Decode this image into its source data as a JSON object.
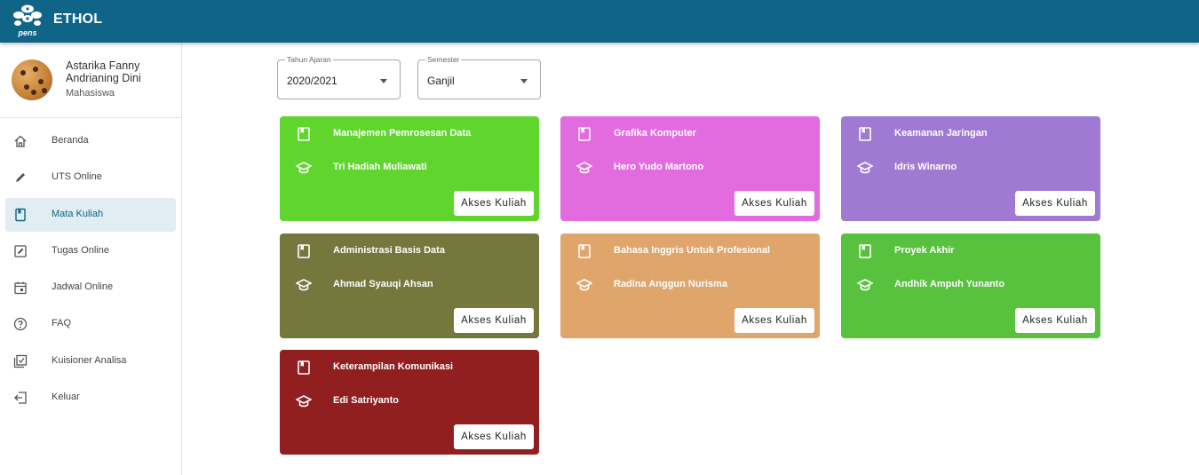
{
  "app": {
    "title": "ETHOL",
    "logo_text": "pens"
  },
  "user": {
    "name": "Astarika Fanny Andrianing Dini",
    "role": "Mahasiswa"
  },
  "nav": [
    {
      "label": "Beranda",
      "icon": "home-icon"
    },
    {
      "label": "UTS Online",
      "icon": "pen-icon"
    },
    {
      "label": "Mata Kuliah",
      "icon": "book-icon",
      "active": true
    },
    {
      "label": "Tugas Online",
      "icon": "edit-icon"
    },
    {
      "label": "Jadwal Online",
      "icon": "calendar-icon"
    },
    {
      "label": "FAQ",
      "icon": "help-icon"
    },
    {
      "label": "Kuisioner Analisa",
      "icon": "checklist-icon"
    },
    {
      "label": "Keluar",
      "icon": "logout-icon"
    }
  ],
  "filters": {
    "tahun": {
      "legend": "Tahun Ajaran",
      "value": "2020/2021"
    },
    "semester": {
      "legend": "Semester",
      "value": "Ganjil"
    }
  },
  "courses": [
    {
      "name": "Manajemen Pemrosesan Data",
      "lecturer": "Tri Hadiah Muliawati",
      "color": "#5fd52e",
      "button": "Akses Kuliah"
    },
    {
      "name": "Grafika Komputer",
      "lecturer": "Hero Yudo Martono",
      "color": "#e36be0",
      "button": "Akses Kuliah"
    },
    {
      "name": "Keamanan Jaringan",
      "lecturer": "Idris Winarno",
      "color": "#a07ad2",
      "button": "Akses Kuliah"
    },
    {
      "name": "Administrasi Basis Data",
      "lecturer": "Ahmad Syauqi Ahsan",
      "color": "#75773c",
      "button": "Akses Kuliah"
    },
    {
      "name": "Bahasa Inggris Untuk Profesional",
      "lecturer": "Radina Anggun Nurisma",
      "color": "#e0a56b",
      "button": "Akses Kuliah"
    },
    {
      "name": "Proyek Akhir",
      "lecturer": "Andhik Ampuh Yunanto",
      "color": "#58c13d",
      "button": "Akses Kuliah"
    },
    {
      "name": "Keterampilan Komunikasi",
      "lecturer": "Edi Satriyanto",
      "color": "#921f20",
      "button": "Akses Kuliah"
    }
  ]
}
